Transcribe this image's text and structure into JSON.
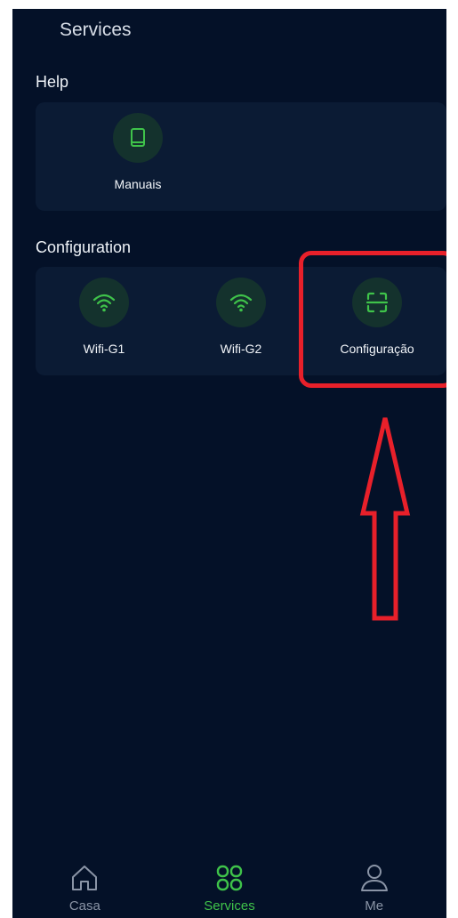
{
  "header": {
    "title": "Services"
  },
  "help": {
    "title": "Help",
    "items": [
      {
        "label": "Manuais",
        "icon": "book-icon"
      }
    ]
  },
  "configuration": {
    "title": "Configuration",
    "items": [
      {
        "label": "Wifi-G1",
        "icon": "wifi-icon"
      },
      {
        "label": "Wifi-G2",
        "icon": "wifi-icon"
      },
      {
        "label": "Configuração",
        "icon": "scan-icon"
      }
    ]
  },
  "bottom_nav": {
    "items": [
      {
        "label": "Casa",
        "icon": "home-icon",
        "active": false
      },
      {
        "label": "Services",
        "icon": "grid-icon",
        "active": true
      },
      {
        "label": "Me",
        "icon": "user-icon",
        "active": false
      }
    ]
  },
  "colors": {
    "background": "#041128",
    "card": "#0b1b34",
    "accent_green": "#3fc34a",
    "annotation_red": "#e8202a"
  }
}
